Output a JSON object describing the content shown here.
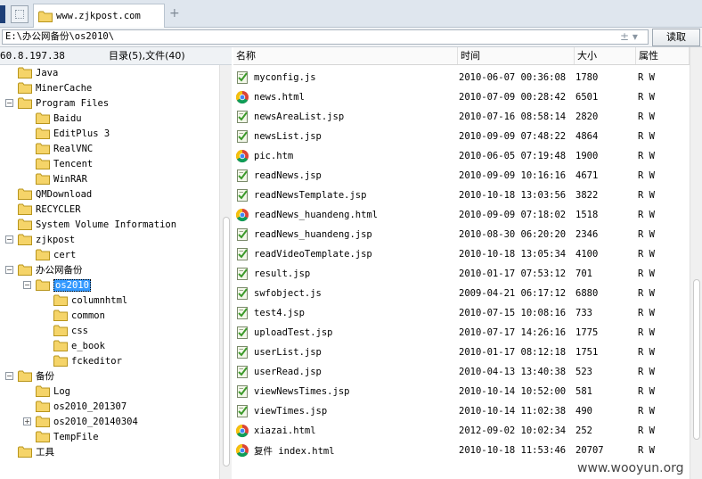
{
  "tab": {
    "title": "www.zjkpost.com",
    "new_tab_symbol": "+"
  },
  "address": {
    "path": "E:\\办公网备份\\os2010\\",
    "tools": "± ▾",
    "read_label": "读取"
  },
  "info": {
    "ip_fragment": "60.8.197.38",
    "summary": "目录(5),文件(40)"
  },
  "tree": [
    {
      "label": "Java",
      "expander": ""
    },
    {
      "label": "MinerCache",
      "expander": ""
    },
    {
      "label": "Program Files",
      "expander": "−"
    },
    {
      "label": "Baidu",
      "expander": ""
    },
    {
      "label": "EditPlus 3",
      "expander": ""
    },
    {
      "label": "RealVNC",
      "expander": ""
    },
    {
      "label": "Tencent",
      "expander": ""
    },
    {
      "label": "WinRAR",
      "expander": ""
    },
    {
      "label": "QMDownload",
      "expander": ""
    },
    {
      "label": "RECYCLER",
      "expander": ""
    },
    {
      "label": "System Volume Information",
      "expander": ""
    },
    {
      "label": "zjkpost",
      "expander": "−"
    },
    {
      "label": "cert",
      "expander": ""
    },
    {
      "label": "办公网备份",
      "expander": "−"
    },
    {
      "label": "os2010",
      "expander": "−"
    },
    {
      "label": "columnhtml",
      "expander": ""
    },
    {
      "label": "common",
      "expander": ""
    },
    {
      "label": "css",
      "expander": ""
    },
    {
      "label": "e_book",
      "expander": ""
    },
    {
      "label": "fckeditor",
      "expander": ""
    },
    {
      "label": "备份",
      "expander": "−"
    },
    {
      "label": "Log",
      "expander": ""
    },
    {
      "label": "os2010_201307",
      "expander": ""
    },
    {
      "label": "os2010_20140304",
      "expander": "+"
    },
    {
      "label": "TempFile",
      "expander": ""
    },
    {
      "label": "工具",
      "expander": ""
    }
  ],
  "columns": {
    "name": "名称",
    "time": "时间",
    "size": "大小",
    "attr": "属性"
  },
  "files": [
    {
      "name": "myconfig.js",
      "time": "2010-06-07 00:36:08",
      "size": "1780",
      "attr": "R W",
      "icon": "script-file-icon"
    },
    {
      "name": "news.html",
      "time": "2010-07-09 00:28:42",
      "size": "6501",
      "attr": "R W",
      "icon": "chrome-html-icon"
    },
    {
      "name": "newsAreaList.jsp",
      "time": "2010-07-16 08:58:14",
      "size": "2820",
      "attr": "R W",
      "icon": "script-file-icon"
    },
    {
      "name": "newsList.jsp",
      "time": "2010-09-09 07:48:22",
      "size": "4864",
      "attr": "R W",
      "icon": "script-file-icon"
    },
    {
      "name": "pic.htm",
      "time": "2010-06-05 07:19:48",
      "size": "1900",
      "attr": "R W",
      "icon": "chrome-html-icon"
    },
    {
      "name": "readNews.jsp",
      "time": "2010-09-09 10:16:16",
      "size": "4671",
      "attr": "R W",
      "icon": "script-file-icon"
    },
    {
      "name": "readNewsTemplate.jsp",
      "time": "2010-10-18 13:03:56",
      "size": "3822",
      "attr": "R W",
      "icon": "script-file-icon"
    },
    {
      "name": "readNews_huandeng.html",
      "time": "2010-09-09 07:18:02",
      "size": "1518",
      "attr": "R W",
      "icon": "chrome-html-icon"
    },
    {
      "name": "readNews_huandeng.jsp",
      "time": "2010-08-30 06:20:20",
      "size": "2346",
      "attr": "R W",
      "icon": "script-file-icon"
    },
    {
      "name": "readVideoTemplate.jsp",
      "time": "2010-10-18 13:05:34",
      "size": "4100",
      "attr": "R W",
      "icon": "script-file-icon"
    },
    {
      "name": "result.jsp",
      "time": "2010-01-17 07:53:12",
      "size": "701",
      "attr": "R W",
      "icon": "script-file-icon"
    },
    {
      "name": "swfobject.js",
      "time": "2009-04-21 06:17:12",
      "size": "6880",
      "attr": "R W",
      "icon": "script-file-icon"
    },
    {
      "name": "test4.jsp",
      "time": "2010-07-15 10:08:16",
      "size": "733",
      "attr": "R W",
      "icon": "script-file-icon"
    },
    {
      "name": "uploadTest.jsp",
      "time": "2010-07-17 14:26:16",
      "size": "1775",
      "attr": "R W",
      "icon": "script-file-icon"
    },
    {
      "name": "userList.jsp",
      "time": "2010-01-17 08:12:18",
      "size": "1751",
      "attr": "R W",
      "icon": "script-file-icon"
    },
    {
      "name": "userRead.jsp",
      "time": "2010-04-13 13:40:38",
      "size": "523",
      "attr": "R W",
      "icon": "script-file-icon"
    },
    {
      "name": "viewNewsTimes.jsp",
      "time": "2010-10-14 10:52:00",
      "size": "581",
      "attr": "R W",
      "icon": "script-file-icon"
    },
    {
      "name": "viewTimes.jsp",
      "time": "2010-10-14 11:02:38",
      "size": "490",
      "attr": "R W",
      "icon": "script-file-icon"
    },
    {
      "name": "xiazai.html",
      "time": "2012-09-02 10:02:34",
      "size": "252",
      "attr": "R W",
      "icon": "chrome-html-icon"
    },
    {
      "name": "复件 index.html",
      "time": "2010-10-18 11:53:46",
      "size": "20707",
      "attr": "R W",
      "icon": "chrome-html-icon"
    }
  ],
  "watermark": "www.wooyun.org",
  "colors": {
    "selection": "#3399ff",
    "folder": "#f5d469",
    "tab_edge": "#1d3f78"
  }
}
